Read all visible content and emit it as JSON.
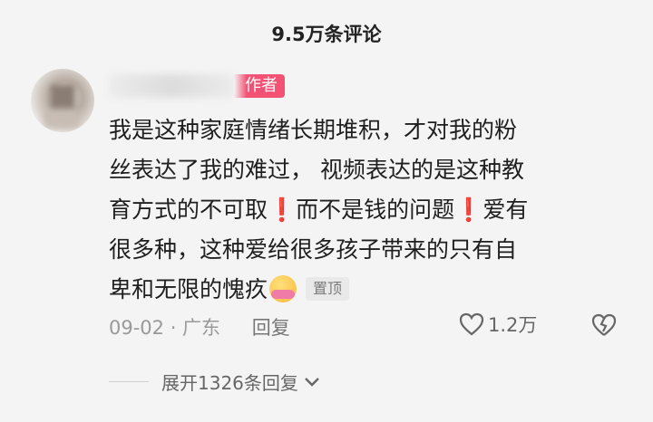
{
  "header": {
    "title": "9.5万条评论"
  },
  "comment": {
    "author_badge": "作者",
    "lines": [
      "我是这种家庭情绪长期堆积，才对我的粉",
      "丝表达了我的难过， 视频表达的是这种教",
      "育方式的不可取",
      "而不是钱的问题",
      "爱有",
      "很多种，这种爱给很多孩子带来的只有自",
      "卑和无限的愧疚"
    ],
    "exclamation": "❗",
    "pin_label": "置顶",
    "date_location": "09-02 · 广东",
    "reply_label": "回复",
    "like_count": "1.2万",
    "expand_label": "展开1326条回复"
  },
  "icons": {
    "avatar": "avatar-image",
    "hug_emoji": "hug-emoji-icon",
    "heart": "heart-icon",
    "broken_heart": "broken-heart-icon",
    "chevron": "chevron-down-icon"
  },
  "colors": {
    "badge": "#f35274",
    "exclamation": "#e53935",
    "background": "#f4f4f4"
  }
}
